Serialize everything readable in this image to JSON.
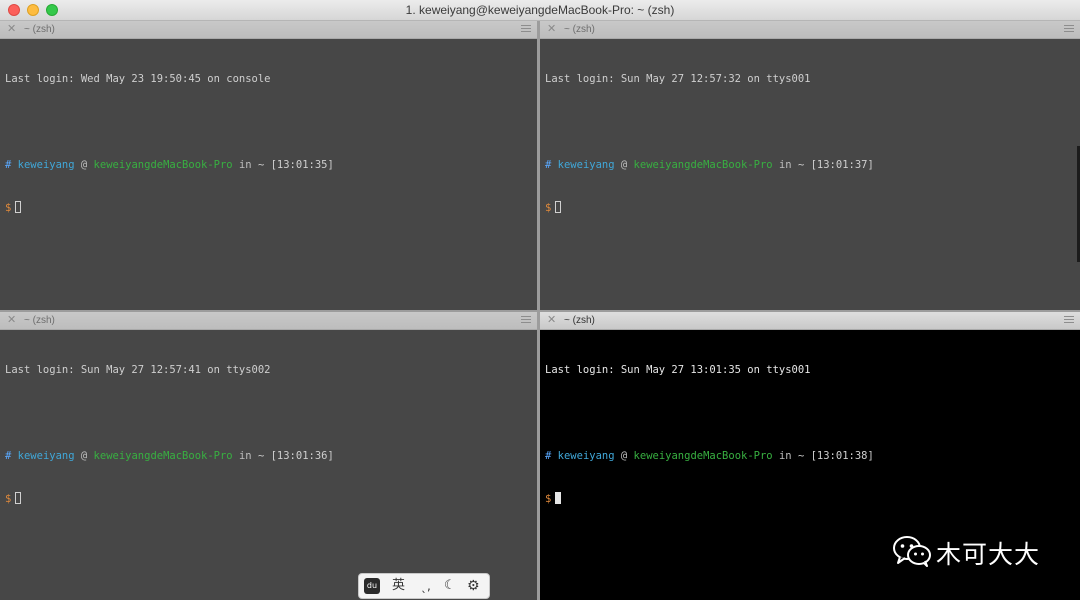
{
  "window": {
    "title": "1. keweiyang@keweiyangdeMacBook-Pro: ~ (zsh)"
  },
  "panes": {
    "top_left": {
      "tab_title": "~ (zsh)",
      "login": "Last login: Wed May 23 19:50:45 on console",
      "prompt": {
        "hash": "#",
        "user": "keweiyang",
        "at": "@",
        "host": "keweiyangdeMacBook-Pro",
        "in": "in",
        "dir": "~",
        "time": "[13:01:35]",
        "symbol": "$"
      }
    },
    "top_right": {
      "tab_title": "~ (zsh)",
      "login": "Last login: Sun May 27 12:57:32 on ttys001",
      "prompt": {
        "hash": "#",
        "user": "keweiyang",
        "at": "@",
        "host": "keweiyangdeMacBook-Pro",
        "in": "in",
        "dir": "~",
        "time": "[13:01:37]",
        "symbol": "$"
      }
    },
    "bottom_left": {
      "tab_title": "~ (zsh)",
      "login": "Last login: Sun May 27 12:57:41 on ttys002",
      "prompt": {
        "hash": "#",
        "user": "keweiyang",
        "at": "@",
        "host": "keweiyangdeMacBook-Pro",
        "in": "in",
        "dir": "~",
        "time": "[13:01:36]",
        "symbol": "$"
      }
    },
    "bottom_right": {
      "tab_title": "~ (zsh)",
      "login": "Last login: Sun May 27 13:01:35 on ttys001",
      "prompt": {
        "hash": "#",
        "user": "keweiyang",
        "at": "@",
        "host": "keweiyangdeMacBook-Pro",
        "in": "in",
        "dir": "~",
        "time": "[13:01:38]",
        "symbol": "$"
      }
    }
  },
  "ime_toolbar": {
    "logo_label": "du",
    "english_label": "英",
    "punct_label": "ˎ,",
    "moon_icon": "☾",
    "settings_icon": "⚙"
  },
  "watermark": {
    "text": "木可大大"
  },
  "colors": {
    "hash": "#5aa9ff",
    "user": "#40a7d8",
    "host": "#38b041",
    "dollar": "#e08a3c",
    "inactive_bg": "#474747",
    "active_bg": "#000000"
  }
}
